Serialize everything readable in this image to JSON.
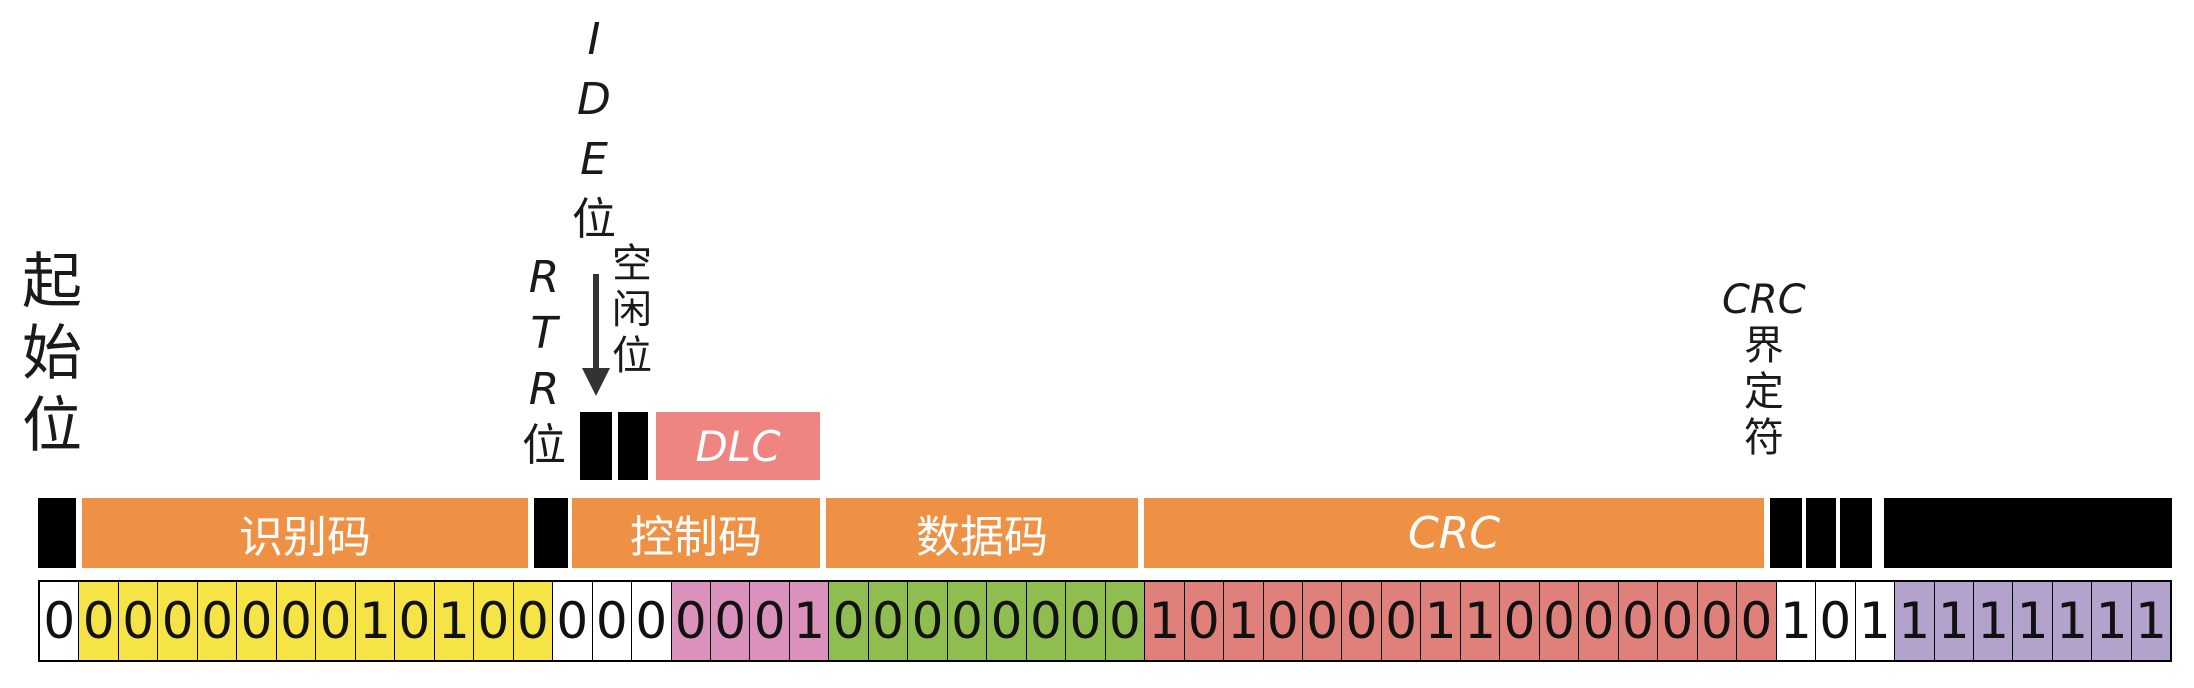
{
  "labels": {
    "start_bit": [
      "起",
      "始",
      "位"
    ],
    "rtr": [
      "R",
      "T",
      "R",
      "位"
    ],
    "ide": [
      "I",
      "D",
      "E",
      "位"
    ],
    "idle": [
      "空",
      "闲",
      "位"
    ],
    "crc_delim": [
      "CRC",
      "界",
      "定",
      "符"
    ],
    "dlc": "DLC"
  },
  "fields": {
    "identifier": "识别码",
    "control": "控制码",
    "data": "数据码",
    "crc": "CRC"
  },
  "colors": {
    "field_bar": "#ef9144",
    "dlc": "#ef8580",
    "start": "#ffffff",
    "identifier_bits": "#f6e346",
    "rtr_ide_idle_bits": "#ffffff",
    "dlc_bits": "#da92bc",
    "data_bits": "#8fbd4f",
    "crc_bits": "#e0807a",
    "delimiter_ack_bits": "#ffffff",
    "eof_bits": "#b3a3cc"
  },
  "bit_groups": [
    {
      "name": "start",
      "bits": [
        "0"
      ]
    },
    {
      "name": "identifier",
      "bits": [
        "0",
        "0",
        "0",
        "0",
        "0",
        "0",
        "0",
        "1",
        "0",
        "1",
        "0",
        "0"
      ]
    },
    {
      "name": "rtr_ide_idle",
      "bits": [
        "0",
        "0",
        "0"
      ]
    },
    {
      "name": "dlc",
      "bits": [
        "0",
        "0",
        "0",
        "1"
      ]
    },
    {
      "name": "data",
      "bits": [
        "0",
        "0",
        "0",
        "0",
        "0",
        "0",
        "0",
        "0"
      ]
    },
    {
      "name": "crc",
      "bits": [
        "1",
        "0",
        "1",
        "0",
        "0",
        "0",
        "0",
        "1",
        "1",
        "0",
        "0",
        "0",
        "0",
        "0",
        "0",
        "0"
      ]
    },
    {
      "name": "delimiter_ack",
      "bits": [
        "1",
        "0",
        "1"
      ]
    },
    {
      "name": "eof",
      "bits": [
        "1",
        "1",
        "1",
        "1",
        "1",
        "1",
        "1"
      ]
    }
  ]
}
